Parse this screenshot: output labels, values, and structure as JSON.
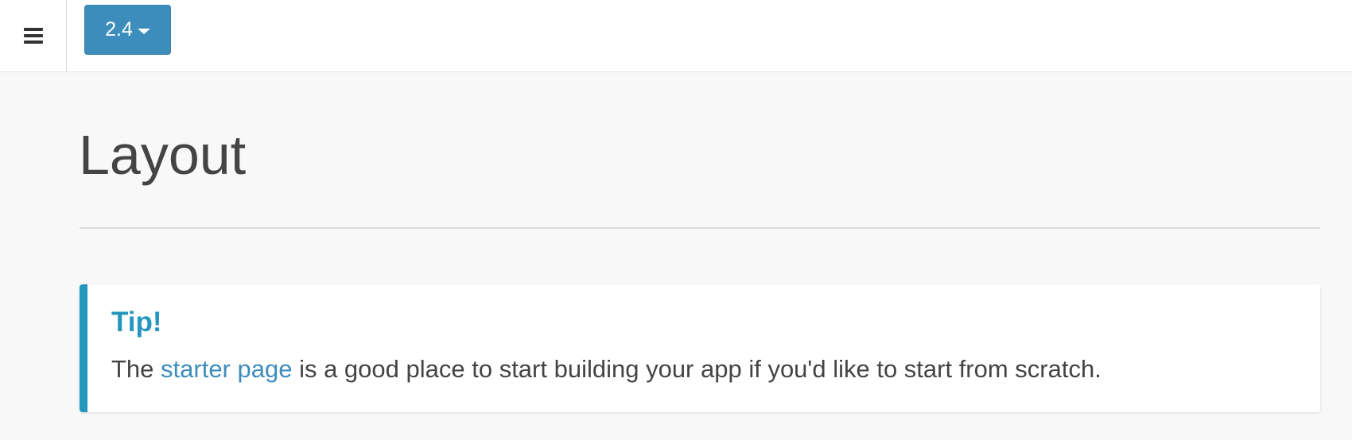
{
  "header": {
    "menu_icon": "hamburger-menu-icon",
    "version_label": "2.4",
    "version_icon": "caret-down-icon"
  },
  "page": {
    "title": "Layout"
  },
  "tip": {
    "title": "Tip!",
    "text_before": "The ",
    "link_text": "starter page",
    "text_after": " is a good place to start building your app if you'd like to start from scratch."
  },
  "colors": {
    "accent": "#3c8dbc",
    "callout_border": "#2596be",
    "page_background": "#f8f8f8"
  }
}
